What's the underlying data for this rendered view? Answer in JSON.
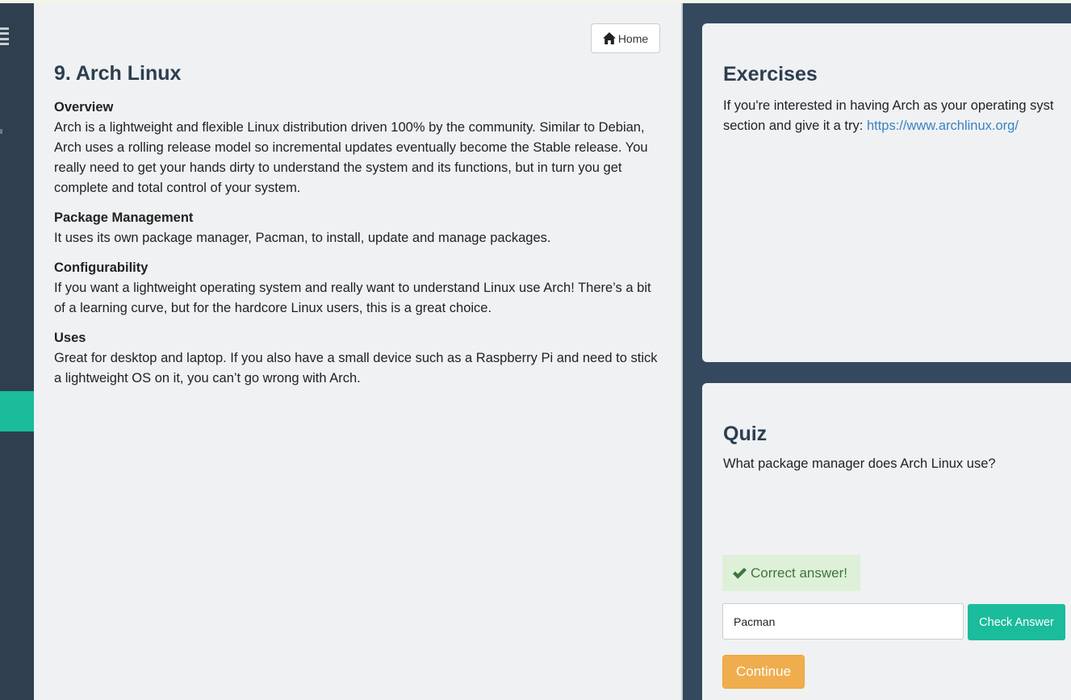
{
  "colors": {
    "sidebar": "#2f3f4f",
    "accent": "#1abc9c",
    "warning": "#f0ad4e",
    "success_bg": "#dff0d8",
    "success_text": "#3c763d",
    "link": "#3a83c2",
    "heading": "#2c3e50"
  },
  "sidebar": {
    "menu_icon": "hamburger-icon"
  },
  "lesson": {
    "home_button": {
      "label": "Home",
      "icon": "home-icon"
    },
    "title": "9. Arch Linux",
    "sections": [
      {
        "heading": "Overview",
        "text": "Arch is a lightweight and flexible Linux distribution driven 100% by the community. Similar to Debian, Arch uses a rolling release model so incremental updates eventually become the Stable release. You really need to get your hands dirty to understand the system and its functions, but in turn you get complete and total control of your system."
      },
      {
        "heading": "Package Management",
        "text": "It uses its own package manager, Pacman, to install, update and manage packages."
      },
      {
        "heading": "Configurability",
        "text": "If you want a lightweight operating system and really want to understand Linux use Arch! There’s a bit of a learning curve, but for the hardcore Linux users, this is a great choice."
      },
      {
        "heading": "Uses",
        "text": "Great for desktop and laptop. If you also have a small device such as a Raspberry Pi and need to stick a lightweight OS on it, you can’t go wrong with Arch."
      }
    ]
  },
  "exercises": {
    "title": "Exercises",
    "text_line1": "If you're interested in having Arch as your operating syst",
    "text_line2_prefix": "section and give it a try: ",
    "link": "https://www.archlinux.org/"
  },
  "quiz": {
    "title": "Quiz",
    "question": "What package manager does Arch Linux use?",
    "feedback": {
      "icon": "check-icon",
      "text": "Correct answer!"
    },
    "answer_value": "Pacman",
    "check_button": "Check Answer",
    "continue_button": "Continue"
  }
}
